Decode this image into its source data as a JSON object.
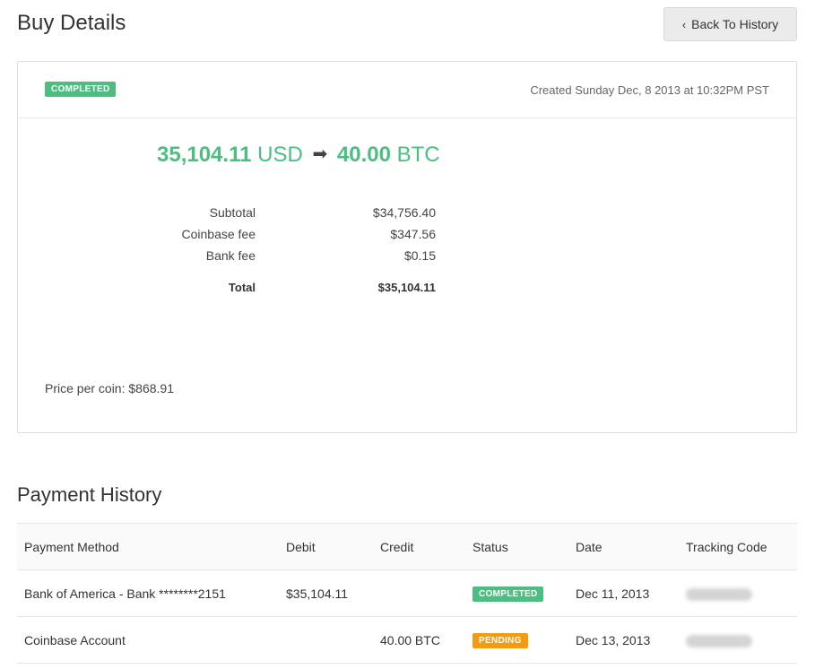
{
  "page": {
    "title": "Buy Details",
    "back_label": "Back To History"
  },
  "card": {
    "status": "COMPLETED",
    "created": "Created Sunday Dec, 8 2013 at 10:32PM PST",
    "amount": {
      "from_value": "35,104.11",
      "from_unit": "USD",
      "to_value": "40.00",
      "to_unit": "BTC"
    },
    "breakdown": [
      {
        "label": "Subtotal",
        "value": "$34,756.40"
      },
      {
        "label": "Coinbase fee",
        "value": "$347.56"
      },
      {
        "label": "Bank fee",
        "value": "$0.15"
      }
    ],
    "total": {
      "label": "Total",
      "value": "$35,104.11"
    },
    "price_per_coin": "Price per coin: $868.91"
  },
  "payment_history": {
    "title": "Payment History",
    "columns": [
      "Payment Method",
      "Debit",
      "Credit",
      "Status",
      "Date",
      "Tracking Code"
    ],
    "rows": [
      {
        "method": "Bank of America - Bank ********2151",
        "debit": "$35,104.11",
        "credit": "",
        "status": "COMPLETED",
        "status_color": "#4cbf80",
        "date": "Dec 11, 2013"
      },
      {
        "method": "Coinbase Account",
        "debit": "",
        "credit": "40.00 BTC",
        "status": "PENDING",
        "status_color": "#f39c12",
        "date": "Dec 13, 2013"
      }
    ]
  },
  "colors": {
    "accent_green": "#4cbf80",
    "pending_orange": "#f39c12"
  }
}
